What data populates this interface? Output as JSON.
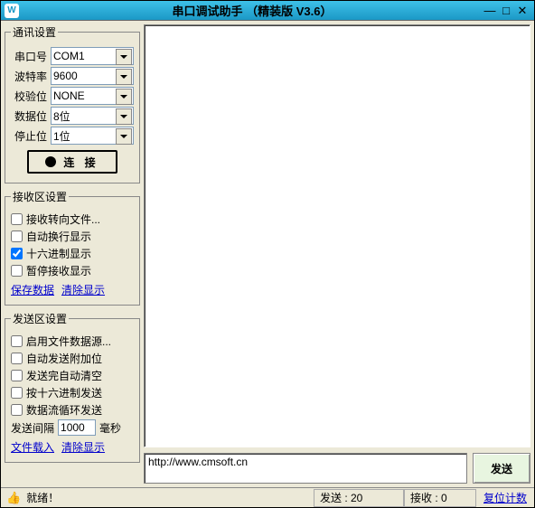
{
  "title": "串口调试助手 （精装版 V3.6）",
  "comm": {
    "legend": "通讯设置",
    "port_label": "串口号",
    "port_value": "COM1",
    "baud_label": "波特率",
    "baud_value": "9600",
    "parity_label": "校验位",
    "parity_value": "NONE",
    "databits_label": "数据位",
    "databits_value": "8位",
    "stopbits_label": "停止位",
    "stopbits_value": "1位",
    "connect": "连 接"
  },
  "recv": {
    "legend": "接收区设置",
    "to_file": "接收转向文件...",
    "auto_wrap": "自动换行显示",
    "hex": "十六进制显示",
    "pause": "暂停接收显示",
    "save": "保存数据",
    "clear": "清除显示"
  },
  "send": {
    "legend": "发送区设置",
    "file_src": "启用文件数据源...",
    "auto_extra": "自动发送附加位",
    "auto_clear": "发送完自动清空",
    "hex_send": "按十六进制发送",
    "loop": "数据流循环发送",
    "interval_label": "发送间隔",
    "interval_value": "1000",
    "interval_unit": "毫秒",
    "load_file": "文件载入",
    "clear": "清除显示"
  },
  "send_input": "http://www.cmsoft.cn",
  "send_button": "发送",
  "status": {
    "ready": "就绪！",
    "sent_label": "发送 :",
    "sent_value": "20",
    "recv_label": "接收 :",
    "recv_value": "0",
    "reset": "复位计数"
  }
}
